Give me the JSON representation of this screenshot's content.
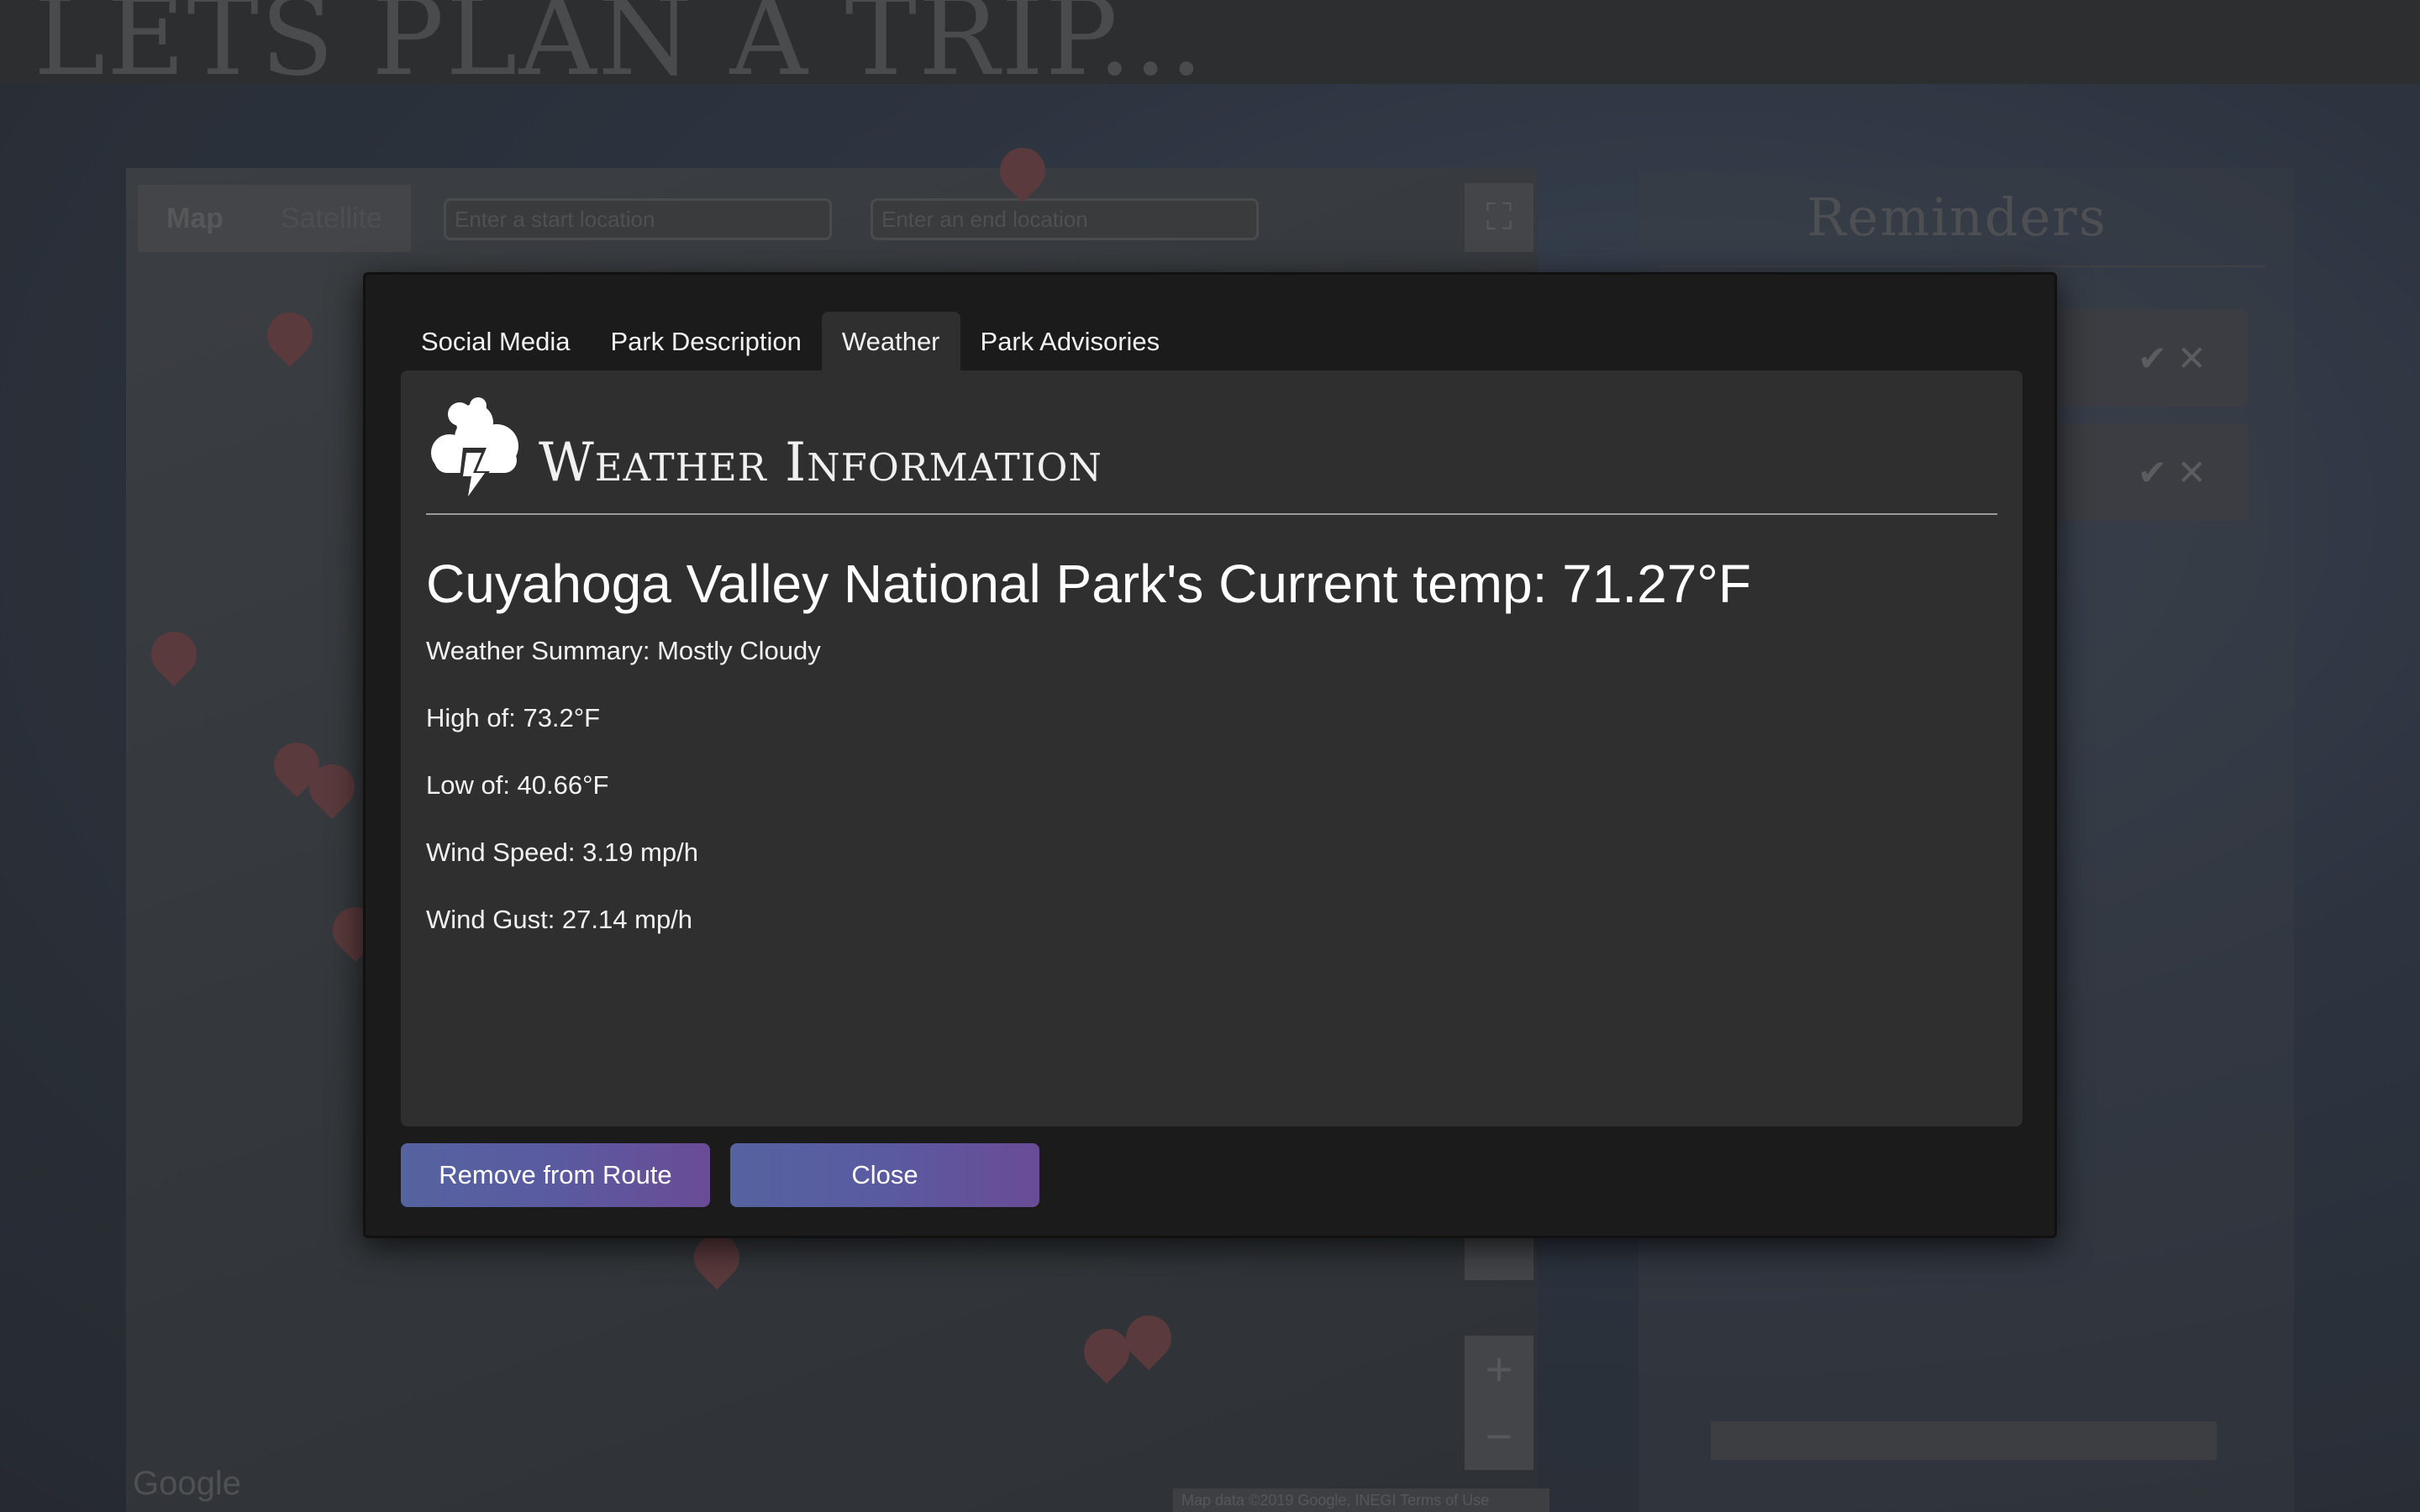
{
  "page": {
    "title": "LETS PLAN A TRIP...",
    "map_types": [
      "Map",
      "Satellite"
    ],
    "start_placeholder": "Enter a start location",
    "end_placeholder": "Enter an end location",
    "google_logo": "Google",
    "map_attribution": "Map data ©2019 Google, INEGI   Terms of Use",
    "zoom_in": "+",
    "zoom_out": "−",
    "fullscreen_glyph": "⛶"
  },
  "reminders": {
    "title": "Reminders",
    "check_glyph": "✔",
    "remove_glyph": "✕"
  },
  "modal": {
    "tabs": [
      "Social Media",
      "Park Description",
      "Weather",
      "Park Advisories"
    ],
    "active_tab": "Weather",
    "weather": {
      "heading": "Weather Information",
      "icon": "cloud-lightning-icon",
      "current_temp": "Cuyahoga Valley National Park's Current temp: 71.27°F",
      "summary": "Weather Summary: Mostly Cloudy",
      "high": "High of: 73.2°F",
      "low": "Low of: 40.66°F",
      "wind_speed": "Wind Speed: 3.19 mp/h",
      "wind_gust": "Wind Gust: 27.14 mp/h"
    },
    "buttons": {
      "remove": "Remove from Route",
      "close": "Close"
    }
  },
  "colors": {
    "modal_bg": "#1b1b1b",
    "panel_bg": "#2f2f2f",
    "button_gradient_start": "#5563a0",
    "button_gradient_end": "#6a4c96"
  }
}
